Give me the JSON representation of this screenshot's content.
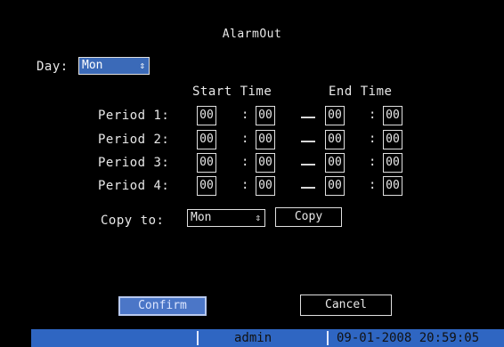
{
  "dialog": {
    "title": "AlarmOut",
    "day_label": "Day:",
    "day_value": "Mon",
    "start_time_label": "Start Time",
    "end_time_label": "End Time",
    "periods": [
      {
        "label": "Period 1:",
        "start_hour": "00",
        "start_min": "00",
        "end_hour": "00",
        "end_min": "00"
      },
      {
        "label": "Period 2:",
        "start_hour": "00",
        "start_min": "00",
        "end_hour": "00",
        "end_min": "00"
      },
      {
        "label": "Period 3:",
        "start_hour": "00",
        "start_min": "00",
        "end_hour": "00",
        "end_min": "00"
      },
      {
        "label": "Period 4:",
        "start_hour": "00",
        "start_min": "00",
        "end_hour": "00",
        "end_min": "00"
      }
    ],
    "time_separator": ":",
    "copy_to_label": "Copy to:",
    "copy_to_value": "Mon",
    "copy_button": "Copy",
    "confirm_button": "Confirm",
    "cancel_button": "Cancel"
  },
  "status_bar": {
    "user": "admin",
    "datetime": "09-01-2008 20:59:05"
  },
  "icons": {
    "select_arrow": "up-down-arrow-icon",
    "range_dash": "dash-icon"
  },
  "colors": {
    "background": "#000000",
    "focus_blue": "#3b6ab8",
    "status_blue": "#2f66c2"
  }
}
